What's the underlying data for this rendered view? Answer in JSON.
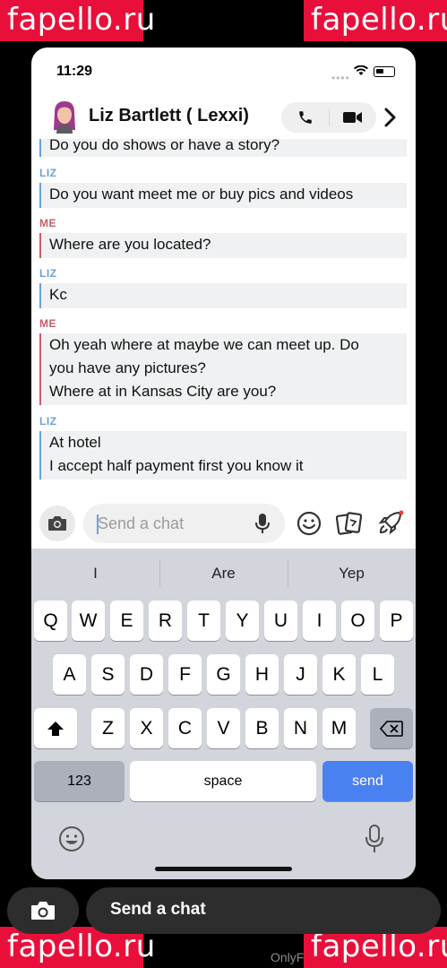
{
  "watermark": {
    "text": "fapello.ru",
    "footer": "OnlyF"
  },
  "status": {
    "time": "11:29",
    "signal": "••••"
  },
  "header": {
    "contact_name": "Liz Bartlett ( Lexxi)"
  },
  "messages": [
    {
      "sender": "",
      "text": "Do you do shows or have a story?",
      "who": "liz"
    },
    {
      "sender": "LIZ",
      "text": "Do you want meet me or buy pics and videos",
      "who": "liz"
    },
    {
      "sender": "ME",
      "text": "Where are you located?",
      "who": "me"
    },
    {
      "sender": "LIZ",
      "text": "Kc",
      "who": "liz"
    },
    {
      "sender": "ME",
      "lines": [
        "Oh yeah where at maybe we can meet up.  Do",
        "you have any pictures?",
        "Where at in Kansas City are you?"
      ],
      "who": "me"
    },
    {
      "sender": "LIZ",
      "lines": [
        "At hotel",
        "I accept half payment  first  you know it"
      ],
      "who": "liz"
    }
  ],
  "composer": {
    "placeholder": "Send a chat"
  },
  "keyboard": {
    "suggestions": [
      "I",
      "Are",
      "Yep"
    ],
    "row1": [
      "Q",
      "W",
      "E",
      "R",
      "T",
      "Y",
      "U",
      "I",
      "O",
      "P"
    ],
    "row2": [
      "A",
      "S",
      "D",
      "F",
      "G",
      "H",
      "J",
      "K",
      "L"
    ],
    "row3": [
      "Z",
      "X",
      "C",
      "V",
      "B",
      "N",
      "M"
    ],
    "numbers_label": "123",
    "space_label": "space",
    "send_label": "send"
  },
  "bottom_bar": {
    "placeholder": "Send a chat"
  },
  "colors": {
    "liz": "#6ca0d6",
    "me": "#c75d6b",
    "send": "#4a81f0",
    "watermark": "#e8103a"
  }
}
